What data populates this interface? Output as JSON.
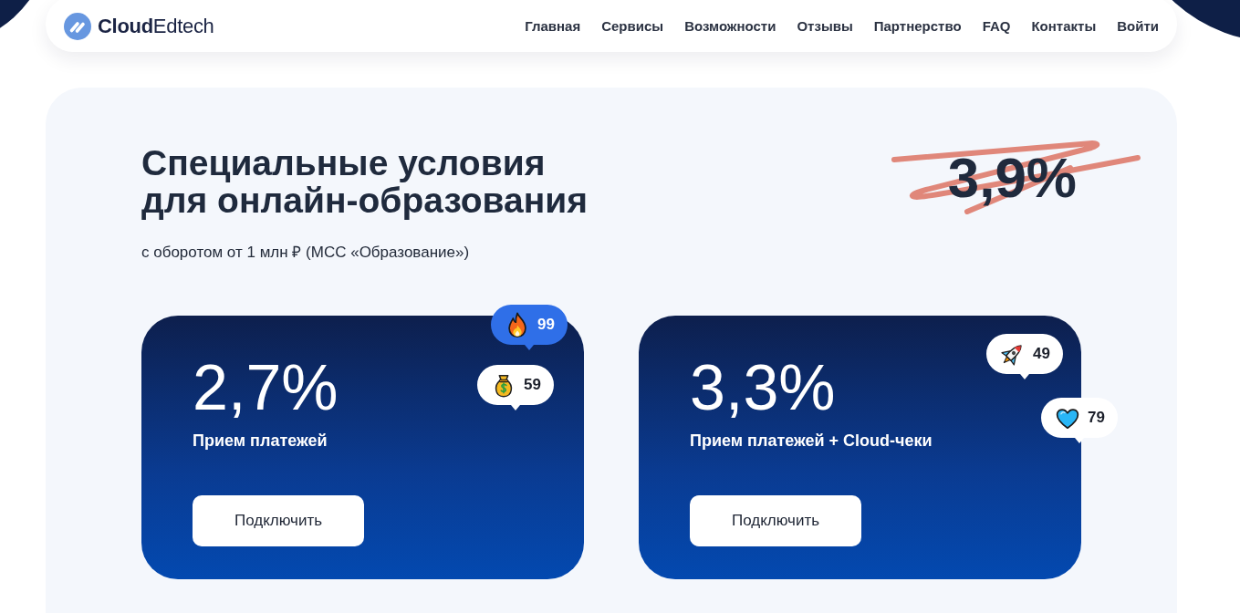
{
  "header": {
    "logo": "**Cloud**Edtech",
    "nav": [
      {
        "label": "Главная"
      },
      {
        "label": "Сервисы"
      },
      {
        "label": "Возможности"
      },
      {
        "label": "Отзывы"
      },
      {
        "label": "Партнерство"
      },
      {
        "label": "FAQ"
      },
      {
        "label": "Контакты"
      },
      {
        "label": "Войти"
      }
    ]
  },
  "offer": {
    "title_lines": [
      "Специальные условия",
      "для онлайн-образования"
    ],
    "subtitle": "с оборотом от 1 млн ₽ (МСС «Образование»)",
    "old_price": "3,9%"
  },
  "cards": [
    {
      "rate": "2,7%",
      "label": "Прием платежей",
      "button": "Подключить",
      "reactions": [
        {
          "kind": "fire",
          "count": "99",
          "selected": true
        },
        {
          "kind": "money-bag",
          "count": "59",
          "selected": false
        }
      ]
    },
    {
      "rate": "3,3%",
      "label": "Прием платежей + Cloud-чеки",
      "button": "Подключить",
      "reactions": [
        {
          "kind": "rocket",
          "count": "49",
          "selected": false
        },
        {
          "kind": "heart",
          "count": "79",
          "selected": false
        }
      ]
    }
  ]
}
